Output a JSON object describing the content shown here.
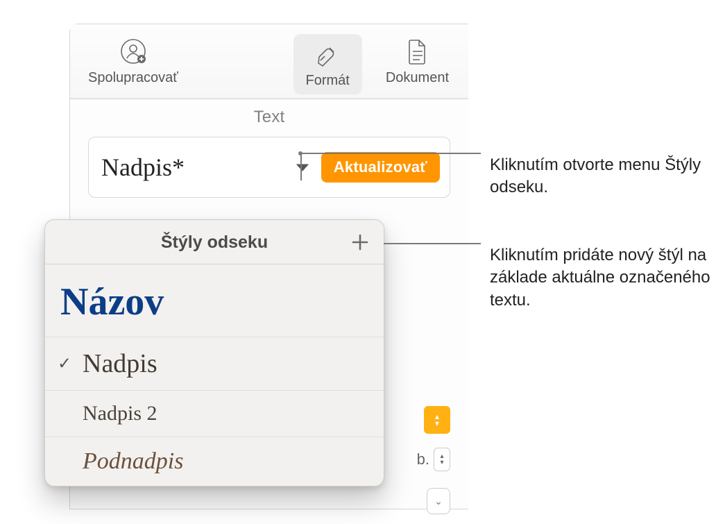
{
  "toolbar": {
    "collaborate_label": "Spolupracovať",
    "format_label": "Formát",
    "document_label": "Dokument"
  },
  "inspector": {
    "section_header": "Text",
    "current_style": "Nadpis*",
    "update_label": "Aktualizovať",
    "peek_suffix": "b."
  },
  "popover": {
    "title": "Štýly odseku",
    "items": {
      "title": "Názov",
      "heading": "Nadpis",
      "heading2": "Nadpis 2",
      "subheading": "Podnadpis"
    }
  },
  "callouts": {
    "open_menu": "Kliknutím otvorte menu Štýly odseku.",
    "add_style": "Kliknutím pridáte nový štýl na základe aktuálne označeného textu."
  }
}
